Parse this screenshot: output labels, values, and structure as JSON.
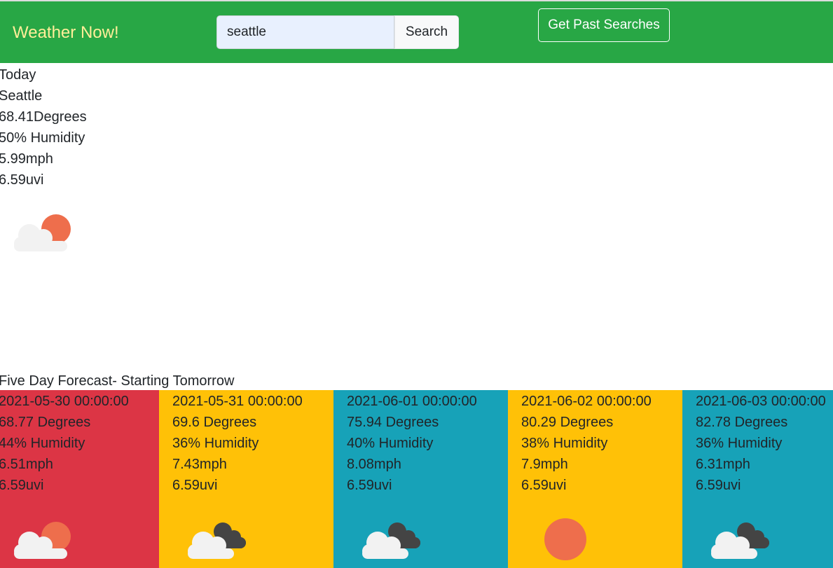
{
  "navbar": {
    "brand": "Weather Now!",
    "search_value": "seattle",
    "search_button": "Search",
    "past_searches_button": "Get Past Searches"
  },
  "today": {
    "label": "Today",
    "city": "Seattle",
    "temp": "68.41Degrees",
    "humidity": "50% Humidity",
    "wind": "5.99mph",
    "uvi": "6.59uvi",
    "icon": "sun-behind-cloud-icon"
  },
  "forecast": {
    "heading": "Five Day Forecast- Starting Tomorrow",
    "days": [
      {
        "date": "2021-05-30 00:00:00",
        "temp": "68.77 Degrees",
        "humidity": "44% Humidity",
        "wind": "6.51mph",
        "uvi": "6.59uvi",
        "color": "#dc3545",
        "icon": "sun-behind-cloud-icon"
      },
      {
        "date": "2021-05-31 00:00:00",
        "temp": "69.6 Degrees",
        "humidity": "36% Humidity",
        "wind": "7.43mph",
        "uvi": "6.59uvi",
        "color": "#ffc107",
        "icon": "cloudy-icon"
      },
      {
        "date": "2021-06-01 00:00:00",
        "temp": "75.94 Degrees",
        "humidity": "40% Humidity",
        "wind": "8.08mph",
        "uvi": "6.59uvi",
        "color": "#17a2b8",
        "icon": "cloudy-icon"
      },
      {
        "date": "2021-06-02 00:00:00",
        "temp": "80.29 Degrees",
        "humidity": "38% Humidity",
        "wind": "7.9mph",
        "uvi": "6.59uvi",
        "color": "#ffc107",
        "icon": "sun-icon"
      },
      {
        "date": "2021-06-03 00:00:00",
        "temp": "82.78 Degrees",
        "humidity": "36% Humidity",
        "wind": "6.31mph",
        "uvi": "6.59uvi",
        "color": "#17a2b8",
        "icon": "cloudy-icon"
      }
    ]
  }
}
